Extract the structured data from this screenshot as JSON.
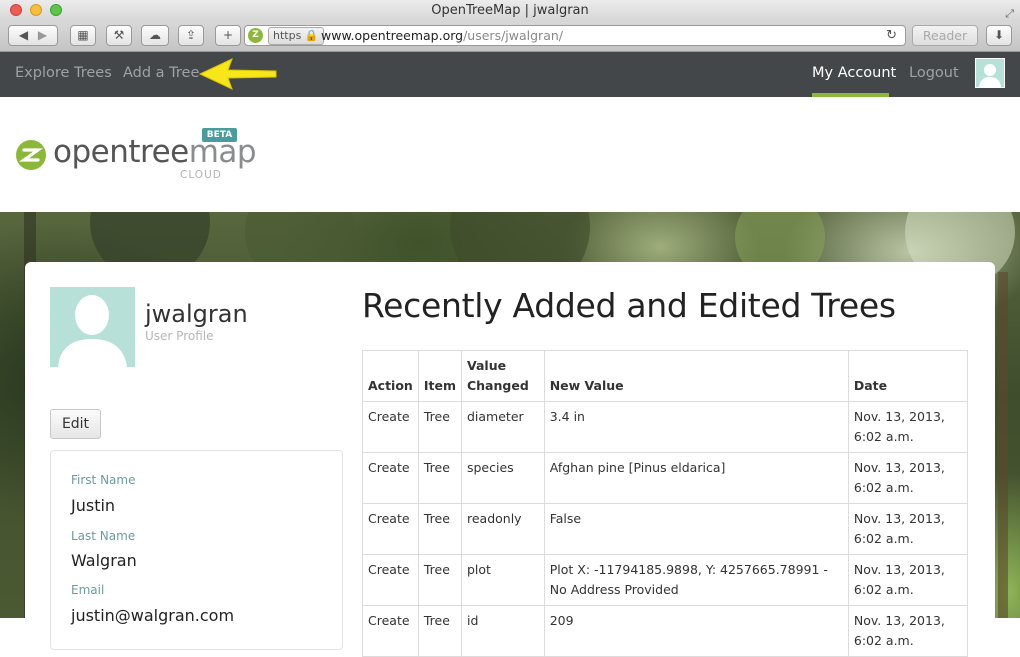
{
  "window": {
    "title": "OpenTreeMap | jwalgran"
  },
  "browser": {
    "https_label": "https",
    "url_host": "www.opentreemap.org",
    "url_path": "/users/jwalgran/",
    "reader_label": "Reader"
  },
  "nav": {
    "left": [
      "Explore Trees",
      "Add a Tree"
    ],
    "my_account": "My Account",
    "logout": "Logout",
    "accent_color": "#8cb83a"
  },
  "logo": {
    "text_dark": "opentree",
    "text_light": "map",
    "badge": "BETA",
    "sub": "CLOUD"
  },
  "profile": {
    "username": "jwalgran",
    "subtitle": "User Profile",
    "edit_label": "Edit",
    "fields": [
      {
        "label": "First Name",
        "value": "Justin"
      },
      {
        "label": "Last Name",
        "value": "Walgran"
      },
      {
        "label": "Email",
        "value": "justin@walgran.com"
      }
    ]
  },
  "recent": {
    "title": "Recently Added and Edited Trees",
    "columns": [
      "Action",
      "Item",
      "Value Changed",
      "New Value",
      "Date"
    ],
    "rows": [
      [
        "Create",
        "Tree",
        "diameter",
        "3.4 in",
        "Nov. 13, 2013, 6:02 a.m."
      ],
      [
        "Create",
        "Tree",
        "species",
        "Afghan pine [Pinus eldarica]",
        "Nov. 13, 2013, 6:02 a.m."
      ],
      [
        "Create",
        "Tree",
        "readonly",
        "False",
        "Nov. 13, 2013, 6:02 a.m."
      ],
      [
        "Create",
        "Tree",
        "plot",
        "Plot X: -11794185.9898, Y: 4257665.78991 - No Address Provided",
        "Nov. 13, 2013, 6:02 a.m."
      ],
      [
        "Create",
        "Tree",
        "id",
        "209",
        "Nov. 13, 2013, 6:02 a.m."
      ]
    ]
  }
}
